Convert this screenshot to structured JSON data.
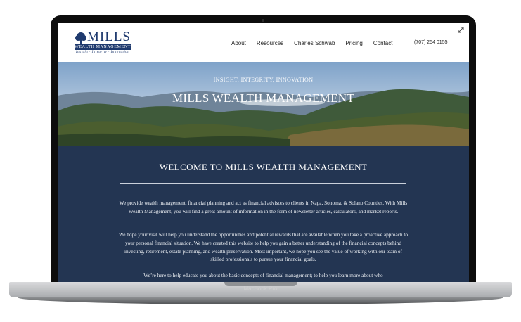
{
  "device": {
    "label": "MacBook Pro"
  },
  "header": {
    "logo": {
      "name": "MILLS",
      "bar_text": "WEALTH MANAGEMENT",
      "tagline": "Insight · Integrity · Innovation"
    },
    "nav": [
      {
        "label": "About"
      },
      {
        "label": "Resources"
      },
      {
        "label": "Charles Schwab"
      },
      {
        "label": "Pricing"
      },
      {
        "label": "Contact"
      }
    ],
    "phone": "(707) 254 0155",
    "expand_icon": "expand-arrows-icon"
  },
  "hero": {
    "tagline": "INSIGHT, INTEGRITY, INNOVATION",
    "title": "MILLS WEALTH MANAGEMENT"
  },
  "main": {
    "heading": "WELCOME TO MILLS WEALTH MANAGEMENT",
    "paragraphs": [
      "We provide wealth management, financial planning and act as financial advisors to clients in Napa, Sonoma, & Solano Counties. With Mills Wealth Management, you will find a great amount of information in the form of newsletter articles, calculators, and market reports.",
      "We hope your visit will help you understand the opportunities and potential rewards that are available when you take a proactive approach to your personal financial situation. We have created this website to help you gain a better understanding of the financial concepts behind investing, retirement, estate planning, and wealth preservation. Most important, we hope you see the value of working with our team of skilled professionals to pursue your financial goals.",
      "We’re here to help educate you about the basic concepts of financial management; to help you learn more about who"
    ]
  },
  "colors": {
    "navy": "#233552",
    "logo_blue": "#1f3a6e",
    "bezel": "#0d0d0d"
  }
}
